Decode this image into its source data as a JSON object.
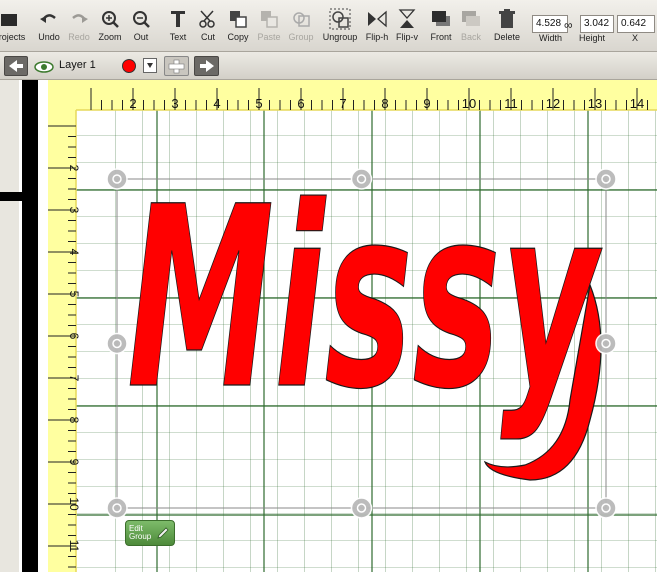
{
  "toolbar": {
    "tools": [
      {
        "label": "Projects",
        "icon": "folder-icon",
        "enabled": true
      },
      {
        "label": "Undo",
        "icon": "undo-icon",
        "enabled": true
      },
      {
        "label": "Redo",
        "icon": "redo-icon",
        "enabled": false
      },
      {
        "label": "Zoom",
        "icon": "zoom-in-icon",
        "enabled": true
      },
      {
        "label": "Out",
        "icon": "zoom-out-icon",
        "enabled": true
      },
      {
        "label": "Text",
        "icon": "text-icon",
        "enabled": true
      },
      {
        "label": "Cut",
        "icon": "scissors-icon",
        "enabled": true
      },
      {
        "label": "Copy",
        "icon": "copy-icon",
        "enabled": true
      },
      {
        "label": "Paste",
        "icon": "paste-icon",
        "enabled": false
      },
      {
        "label": "Group",
        "icon": "group-icon",
        "enabled": false
      },
      {
        "label": "Ungroup",
        "icon": "ungroup-icon",
        "enabled": true
      },
      {
        "label": "Flip-h",
        "icon": "flip-horizontal-icon",
        "enabled": true
      },
      {
        "label": "Flip-v",
        "icon": "flip-vertical-icon",
        "enabled": true
      },
      {
        "label": "Front",
        "icon": "bring-front-icon",
        "enabled": true
      },
      {
        "label": "Back",
        "icon": "send-back-icon",
        "enabled": false
      },
      {
        "label": "Delete",
        "icon": "trash-icon",
        "enabled": true
      }
    ],
    "width_value": "4.528",
    "height_value": "3.042",
    "x_value": "0.642",
    "width_label": "Width",
    "height_label": "Height",
    "x_label": "X"
  },
  "layer": {
    "name": "Layer 1",
    "color": "#ff0000"
  },
  "canvas": {
    "text": "Missy",
    "fill_color": "#ff0000",
    "mat_color": "#ffffa0",
    "grid_color": "#2f6b2f",
    "ruler_top_labels": [
      "2",
      "3",
      "4",
      "5",
      "6",
      "7",
      "8",
      "9",
      "10",
      "11",
      "12",
      "13",
      "14"
    ],
    "ruler_left_labels": [
      "2",
      "3",
      "4",
      "5",
      "6",
      "7",
      "8",
      "9",
      "10",
      "11"
    ],
    "outer_ruler_labels": [
      "1",
      "2",
      "3",
      "4"
    ]
  },
  "edit_group": {
    "label": "Edit Group"
  }
}
